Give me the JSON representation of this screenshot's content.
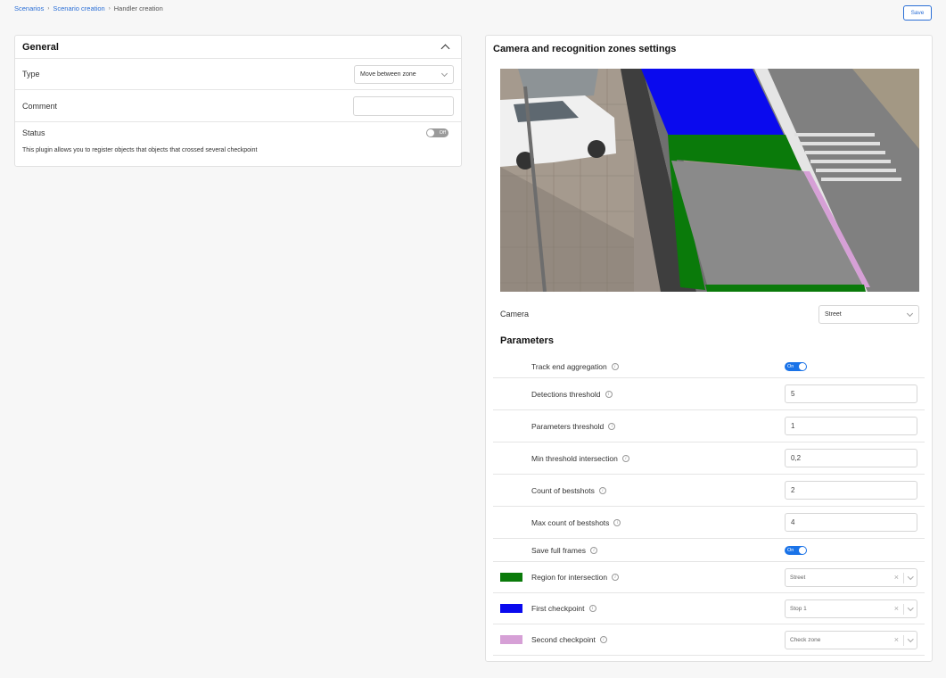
{
  "breadcrumb": {
    "items": [
      "Scenarios",
      "Scenario creation"
    ],
    "current": "Handler creation"
  },
  "toolbar": {
    "save_label": "Save"
  },
  "general": {
    "title": "General",
    "type_label": "Type",
    "type_value": "Move between zone",
    "comment_label": "Comment",
    "comment_value": "",
    "status_label": "Status",
    "status_toggle": "Off",
    "description": "This plugin allows you to register objects that objects that crossed several checkpoint"
  },
  "camera_settings": {
    "title": "Camera and recognition zones settings",
    "camera_label": "Camera",
    "camera_value": "Street",
    "zone_colors": {
      "intersection": "#0a7a0a",
      "first": "#0a0aee",
      "second": "#d6a0d6"
    }
  },
  "parameters": {
    "title": "Parameters",
    "track_end_aggregation": {
      "label": "Track end aggregation",
      "value": "On"
    },
    "detections_threshold": {
      "label": "Detections threshold",
      "value": "5"
    },
    "parameters_threshold": {
      "label": "Parameters threshold",
      "value": "1"
    },
    "min_threshold_intersection": {
      "label": "Min threshold intersection",
      "value": "0,2"
    },
    "count_of_bestshots": {
      "label": "Count of bestshots",
      "value": "2"
    },
    "max_count_of_bestshots": {
      "label": "Max count of bestshots",
      "value": "4"
    },
    "save_full_frames": {
      "label": "Save full frames",
      "value": "On"
    },
    "region_for_intersection": {
      "label": "Region for intersection",
      "value": "Street"
    },
    "first_checkpoint": {
      "label": "First checkpoint",
      "value": "Stop 1"
    },
    "second_checkpoint": {
      "label": "Second checkpoint",
      "value": "Check zone"
    }
  }
}
